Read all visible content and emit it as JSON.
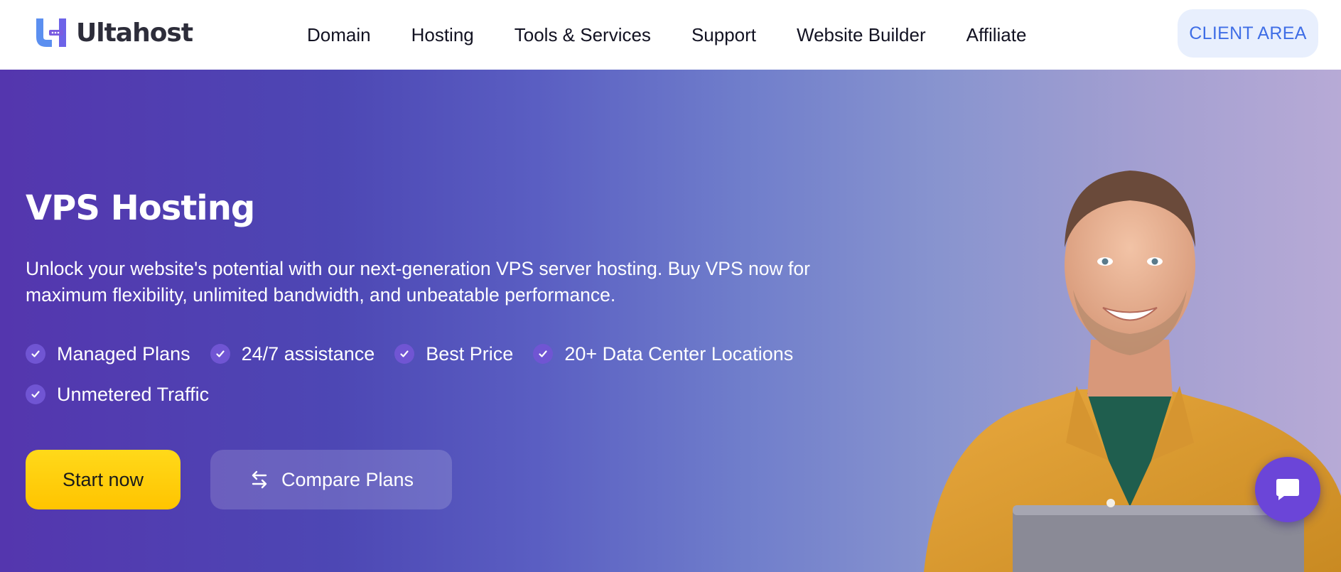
{
  "brand": {
    "name": "Ultahost",
    "logo_mark": "U-H-logo"
  },
  "nav": {
    "items": [
      {
        "label": "Domain"
      },
      {
        "label": "Hosting"
      },
      {
        "label": "Tools & Services"
      },
      {
        "label": "Support"
      },
      {
        "label": "Website Builder"
      },
      {
        "label": "Affiliate"
      }
    ],
    "client_area_label": "CLIENT AREA"
  },
  "hero": {
    "title": "VPS Hosting",
    "description": "Unlock your website's potential with our next-generation VPS server hosting. Buy VPS now for maximum flexibility, unlimited bandwidth, and unbeatable performance.",
    "features": [
      {
        "label": "Managed Plans",
        "icon": "check-icon"
      },
      {
        "label": "24/7 assistance",
        "icon": "check-icon"
      },
      {
        "label": "Best Price",
        "icon": "check-icon"
      },
      {
        "label": "20+ Data Center Locations",
        "icon": "check-icon"
      },
      {
        "label": "Unmetered Traffic",
        "icon": "check-icon"
      }
    ],
    "primary_button": "Start now",
    "secondary_button": "Compare Plans",
    "secondary_icon": "swap-arrows-icon"
  },
  "chat": {
    "icon": "chat-bubble-icon"
  },
  "colors": {
    "accent_yellow": "#ffc400",
    "hero_purple": "#5436ae",
    "client_area_text": "#3f6ee6",
    "check_bg": "#7055d3"
  }
}
